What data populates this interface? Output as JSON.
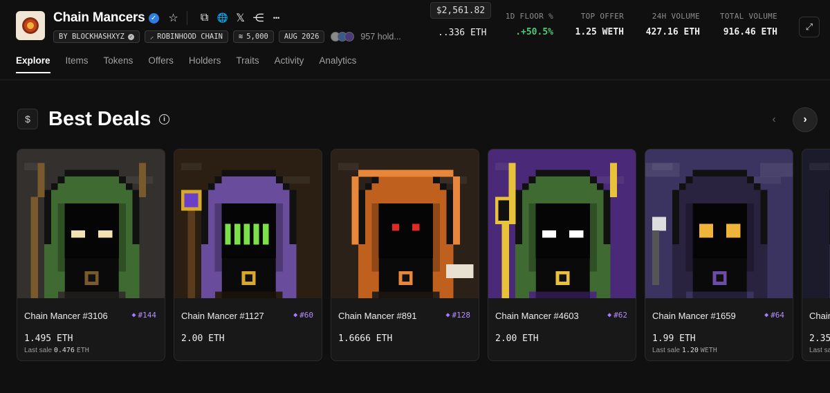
{
  "header": {
    "title": "Chain Mancers",
    "verified_mark": "✓",
    "actions": [
      {
        "name": "star-icon",
        "glyph": "☆"
      },
      {
        "name": "copy-icon",
        "glyph": "⧉"
      },
      {
        "name": "globe-icon",
        "glyph": "🌐"
      },
      {
        "name": "x-icon",
        "glyph": "𝕏"
      },
      {
        "name": "share-icon",
        "glyph": "⋲"
      },
      {
        "name": "more-icon",
        "glyph": "•••"
      }
    ],
    "chips": {
      "creator": "BY BLOCKHASHXYZ",
      "chain": "ROBINHOOD CHAIN",
      "supply": "5,000",
      "date": "AUG 2026"
    },
    "holders": "957 hold..."
  },
  "stats": {
    "price_tooltip": "$2,561.82",
    "floor_value": "..336 ETH",
    "items": [
      {
        "label": "1D FLOOR %",
        "value": ".+50.5%",
        "green": true
      },
      {
        "label": "TOP OFFER",
        "value": "1.25 WETH"
      },
      {
        "label": "24H VOLUME",
        "value": "427.16 ETH"
      },
      {
        "label": "TOTAL VOLUME",
        "value": "916.46 ETH"
      }
    ]
  },
  "tabs": [
    "Explore",
    "Items",
    "Tokens",
    "Offers",
    "Holders",
    "Traits",
    "Activity",
    "Analytics"
  ],
  "section": {
    "icon_glyph": "$",
    "title": "Best Deals",
    "info_glyph": "i",
    "prev_glyph": "‹",
    "next_glyph": "›"
  },
  "cards": [
    {
      "name": "Chain Mancer #3106",
      "rank": "#144",
      "price": "1.495 ETH",
      "last_sale_label": "Last sale",
      "last_sale_value": "0.476",
      "last_sale_unit": "ETH",
      "bg": "#33302e",
      "hood": "#3f6b32",
      "eye": "#f1e4b0",
      "accent": "#7a5a2c"
    },
    {
      "name": "Chain Mancer #1127",
      "rank": "#60",
      "price": "2.00 ETH",
      "bg": "#2a1f12",
      "hood": "#6a4c9c",
      "eye": "#7be04a",
      "accent": "#d8a82c"
    },
    {
      "name": "Chain Mancer #891",
      "rank": "#128",
      "price": "1.6666 ETH",
      "bg": "#2c2118",
      "hood": "#c0601e",
      "eye": "#e02a22",
      "accent": "#e8873a"
    },
    {
      "name": "Chain Mancer #4603",
      "rank": "#62",
      "price": "2.00 ETH",
      "bg": "#4a2a78",
      "hood": "#3f6b32",
      "eye": "#ffffff",
      "accent": "#e8c23a"
    },
    {
      "name": "Chain Mancer #1659",
      "rank": "#64",
      "price": "1.99 ETH",
      "last_sale_label": "Last sale",
      "last_sale_value": "1.20",
      "last_sale_unit": "WETH",
      "bg": "#3b3460",
      "hood": "#2a2340",
      "eye": "#f0b43a",
      "accent": "#6b4ca6"
    },
    {
      "name": "Chain Mancer",
      "rank": "",
      "price": "2.35",
      "last_sale_label": "Last sa",
      "last_sale_value": "",
      "last_sale_unit": "",
      "bg": "#1c1b2c",
      "hood": "#2b2944",
      "eye": "#d84a3a",
      "accent": "#6b4ca6"
    }
  ]
}
